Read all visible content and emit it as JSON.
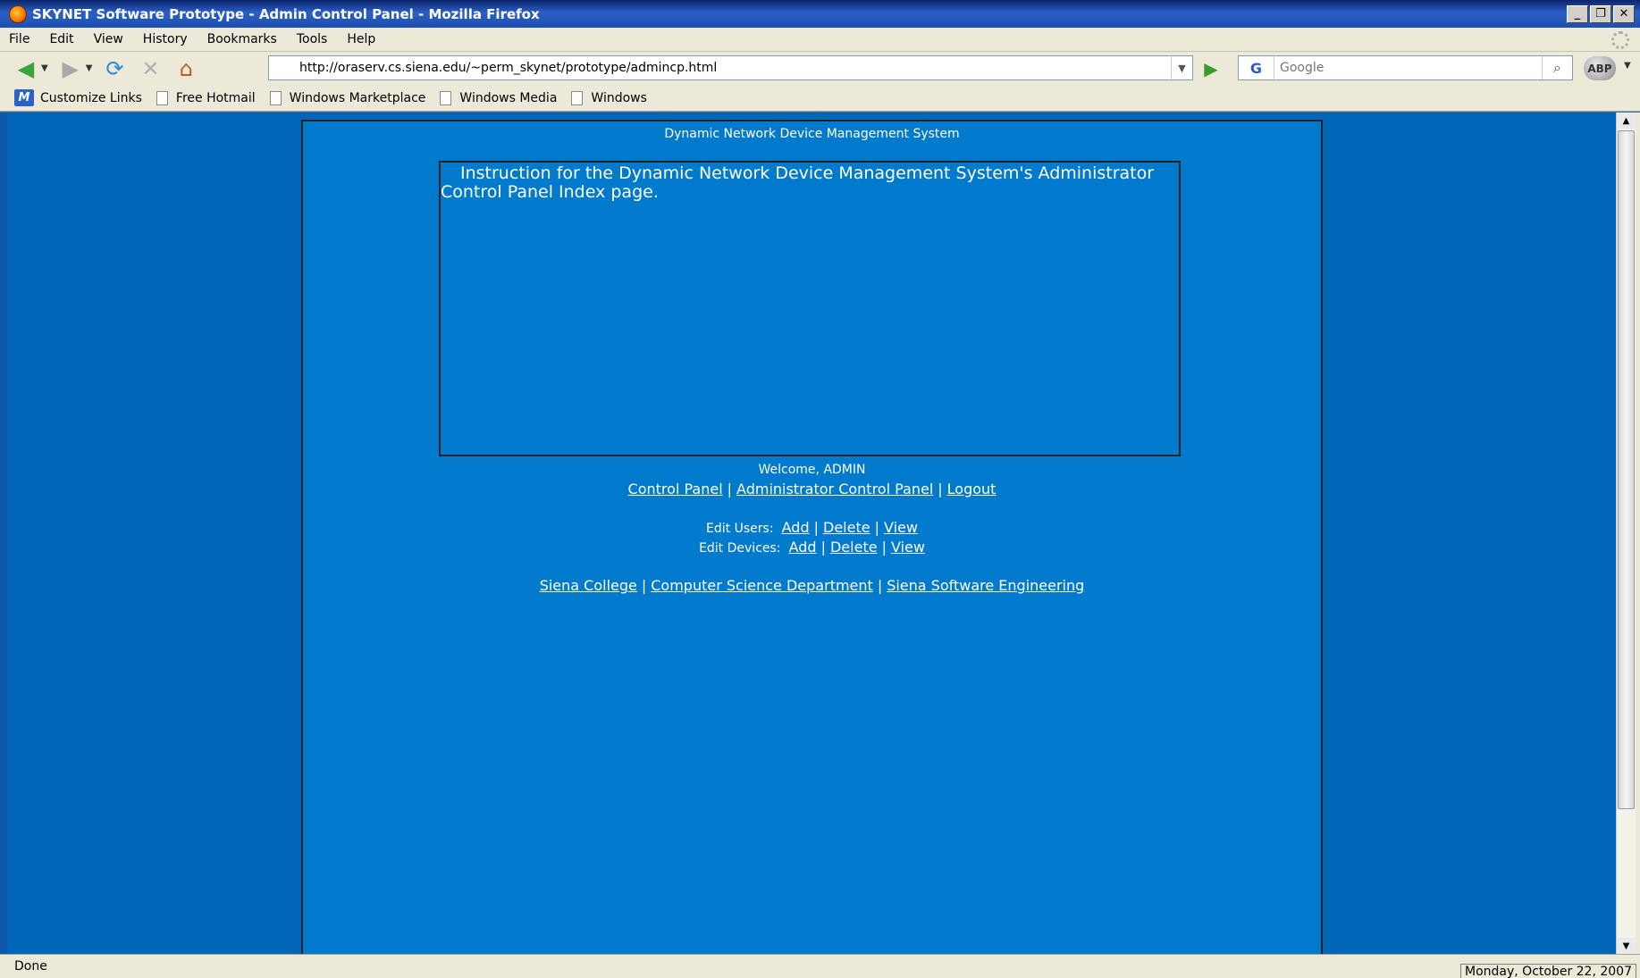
{
  "window": {
    "title": "SKYNET Software Prototype - Admin Control Panel - Mozilla Firefox",
    "buttons": {
      "minimize": "_",
      "restore": "❐",
      "close": "✕"
    }
  },
  "menu": [
    {
      "label": "File"
    },
    {
      "label": "Edit"
    },
    {
      "label": "View"
    },
    {
      "label": "History"
    },
    {
      "label": "Bookmarks"
    },
    {
      "label": "Tools"
    },
    {
      "label": "Help"
    }
  ],
  "toolbar": {
    "icons": {
      "back": "◀",
      "forward": "▶",
      "reload": "⟳",
      "stop": "✕",
      "home": "⌂",
      "go": "▶",
      "search": "⌕"
    },
    "url": "http://oraserv.cs.siena.edu/~perm_skynet/prototype/admincp.html",
    "search_engine_glyph": "G",
    "search_placeholder": "Google",
    "abp_label": "ABP"
  },
  "bookmarks": [
    {
      "label": "Customize Links",
      "icon": "msn-icon"
    },
    {
      "label": "Free Hotmail",
      "icon": "page-icon"
    },
    {
      "label": "Windows Marketplace",
      "icon": "page-icon"
    },
    {
      "label": "Windows Media",
      "icon": "page-icon"
    },
    {
      "label": "Windows",
      "icon": "page-icon"
    }
  ],
  "page": {
    "system_title": "Dynamic Network Device Management System",
    "instructions": "Instruction for the Dynamic Network Device Management System's Administrator Control Panel Index page.",
    "welcome": "Welcome, ADMIN",
    "main_links": [
      "Control Panel",
      "Administrator Control Panel",
      "Logout"
    ],
    "edit_users": {
      "label": "Edit Users:",
      "links": [
        "Add",
        "Delete",
        "View"
      ]
    },
    "edit_devices": {
      "label": "Edit Devices:",
      "links": [
        "Add",
        "Delete",
        "View"
      ]
    },
    "footer_links": [
      "Siena College",
      "Computer Science Department",
      "Siena Software Engineering"
    ],
    "separator": "|"
  },
  "status": {
    "text": "Done",
    "date": "Monday, October 22, 2007"
  },
  "colors": {
    "page_bg": "#007acc",
    "viewport_bg": "#0066b8",
    "chrome": "#ece9d8"
  }
}
